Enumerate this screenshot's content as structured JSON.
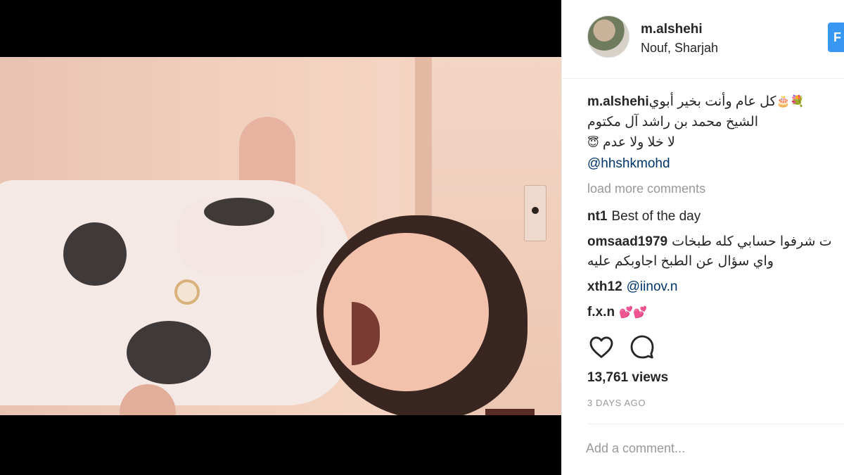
{
  "post": {
    "username": "m.alshehi",
    "location": "Nouf, Sharjah",
    "follow_label": "F",
    "caption": {
      "username": "m.alshehi",
      "line1": "كل عام وأنت بخير أبوي",
      "line2": "الشيخ محمد بن راشد آل مكتوم",
      "line3": "لا خلا ولا عدم",
      "mention": "@hhshkmohd"
    },
    "load_more_label": "load more comments",
    "comments": [
      {
        "username": "nt1",
        "text": "Best of the day"
      },
      {
        "username": "omsaad1979",
        "text": "ت شرفوا حسابي كله طبخات",
        "text_line2": "واي سؤال عن الطبخ اجاوبكم عليه"
      },
      {
        "username": "xth12",
        "text": "@iinov.n"
      },
      {
        "username": "f.x.n",
        "text": "💕💕"
      }
    ],
    "views": "13,761 views",
    "time_ago": "3 DAYS AGO",
    "add_comment_placeholder": "Add a comment..."
  },
  "icons": {
    "like": "heart-outline-icon",
    "comment": "speech-bubble-icon"
  },
  "colors": {
    "follow_button": "#3897f0",
    "link": "#003569",
    "muted": "#999999",
    "media_background": "#000000"
  }
}
